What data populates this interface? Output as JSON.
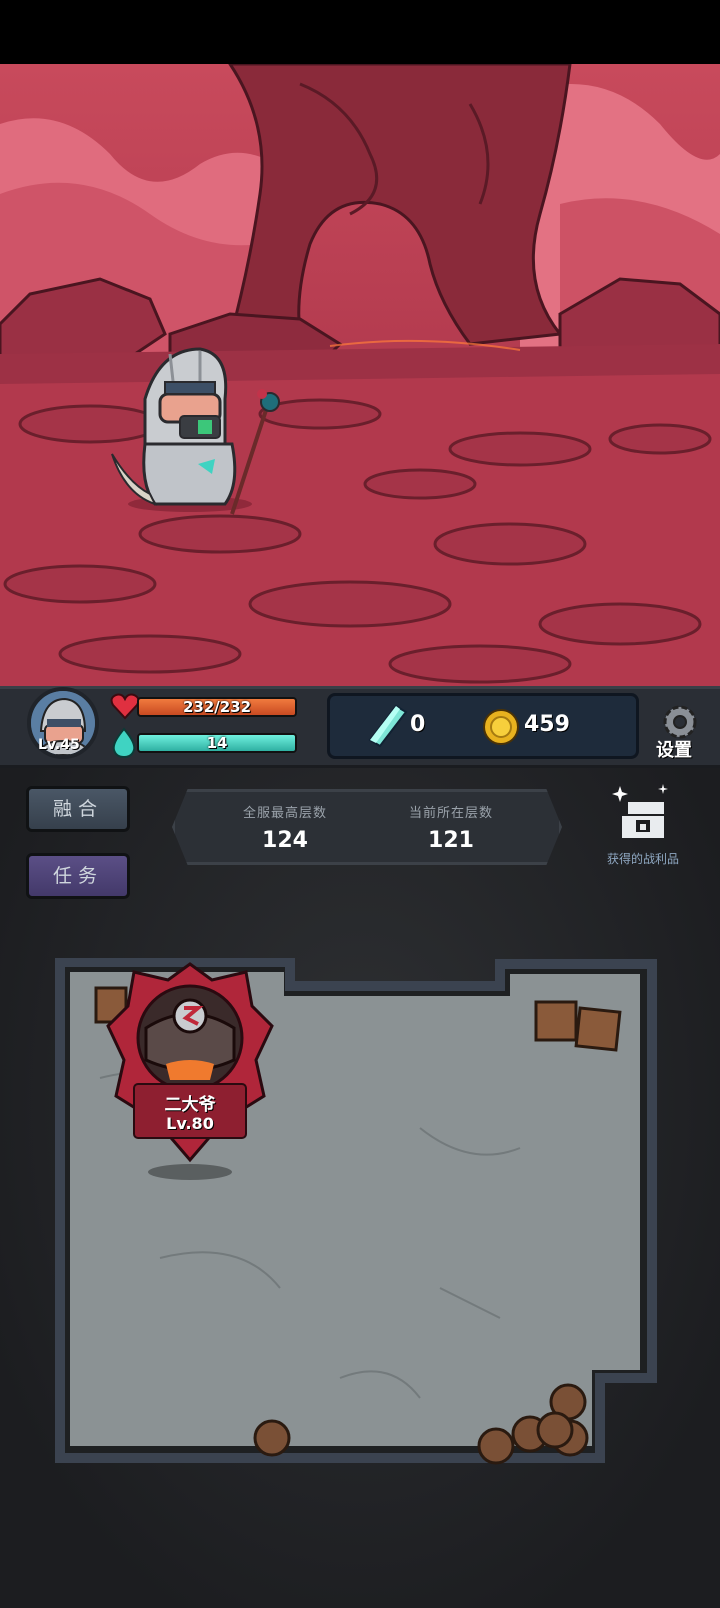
{
  "hud": {
    "level": "Lv.45",
    "hp_text": "232/232",
    "hp_fraction": 1.0,
    "mp_text": "14",
    "mp_fraction": 1.0,
    "gems": "0",
    "gold": "459",
    "settings_label": "设置"
  },
  "side_buttons": {
    "fusion": "融合",
    "quest": "任务"
  },
  "floors": {
    "best_label": "全服最高层数",
    "best_value": "124",
    "current_label": "当前所在层数",
    "current_value": "121"
  },
  "loot": {
    "label": "获得的战利品"
  },
  "enemy": {
    "name": "二大爷",
    "level": "Lv.80"
  },
  "colors": {
    "hp": "#e0642e",
    "mp": "#3fd3c2",
    "scene_sky": "#d25a6c",
    "panel": "#2a2e35"
  }
}
